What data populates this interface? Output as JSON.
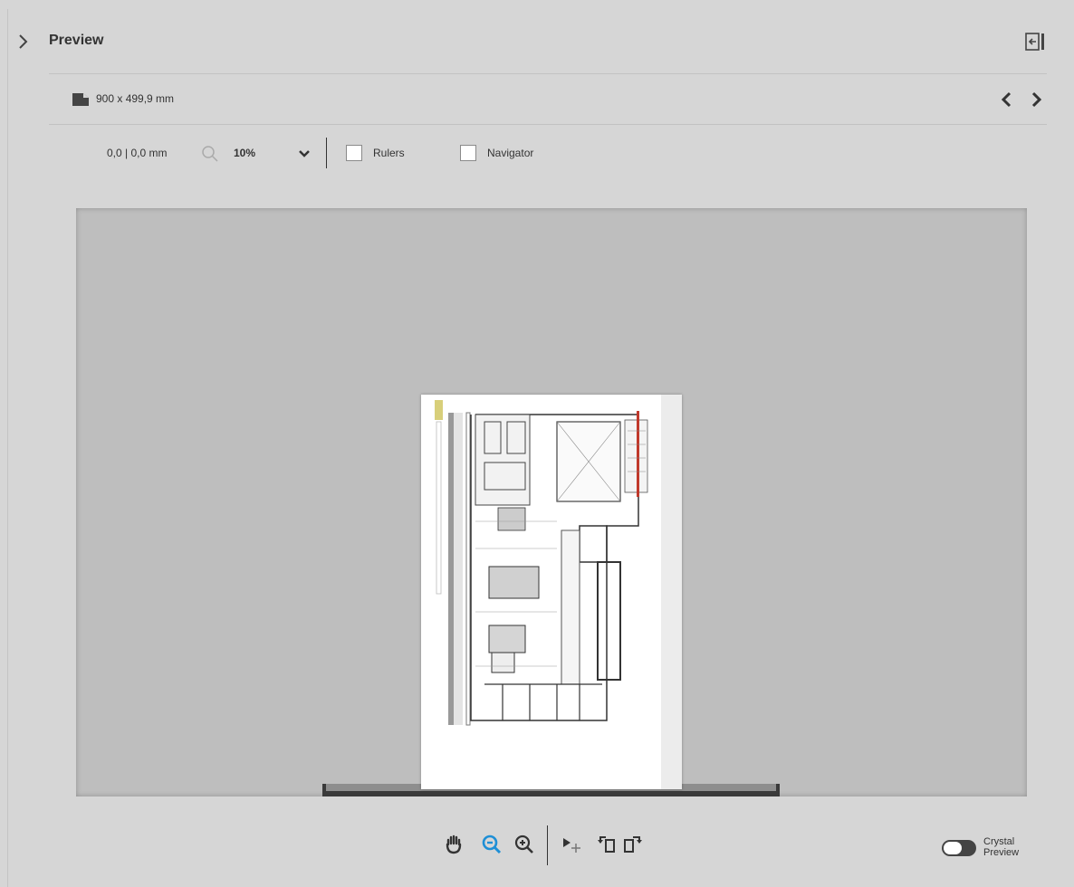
{
  "header": {
    "title": "Preview",
    "collapse_icon": "chevron-right-icon",
    "dock_icon": "panel-dock-icon"
  },
  "document": {
    "page_size": "900 x 499,9 mm",
    "page_icon": "page-size-icon",
    "prev_icon": "chevron-left-icon",
    "next_icon": "chevron-right-icon"
  },
  "toolbar": {
    "coordinates": "0,0 | 0,0 mm",
    "zoom_icon": "magnifier-icon",
    "zoom_value": "10%",
    "zoom_dropdown_icon": "chevron-down-icon",
    "rulers": {
      "label": "Rulers",
      "checked": false
    },
    "navigator": {
      "label": "Navigator",
      "checked": false
    }
  },
  "bottom_tools": {
    "pan": "hand-icon",
    "zoom_out": "zoom-out-icon",
    "zoom_in": "zoom-in-icon",
    "move_image": "move-arrow-icon",
    "rotate_left": "rotate-left-icon",
    "rotate_right": "rotate-right-icon",
    "zoom_out_color": "#1e8fd6",
    "crystal_preview": {
      "line1": "Crystal",
      "line2": "Preview",
      "enabled": false
    }
  }
}
